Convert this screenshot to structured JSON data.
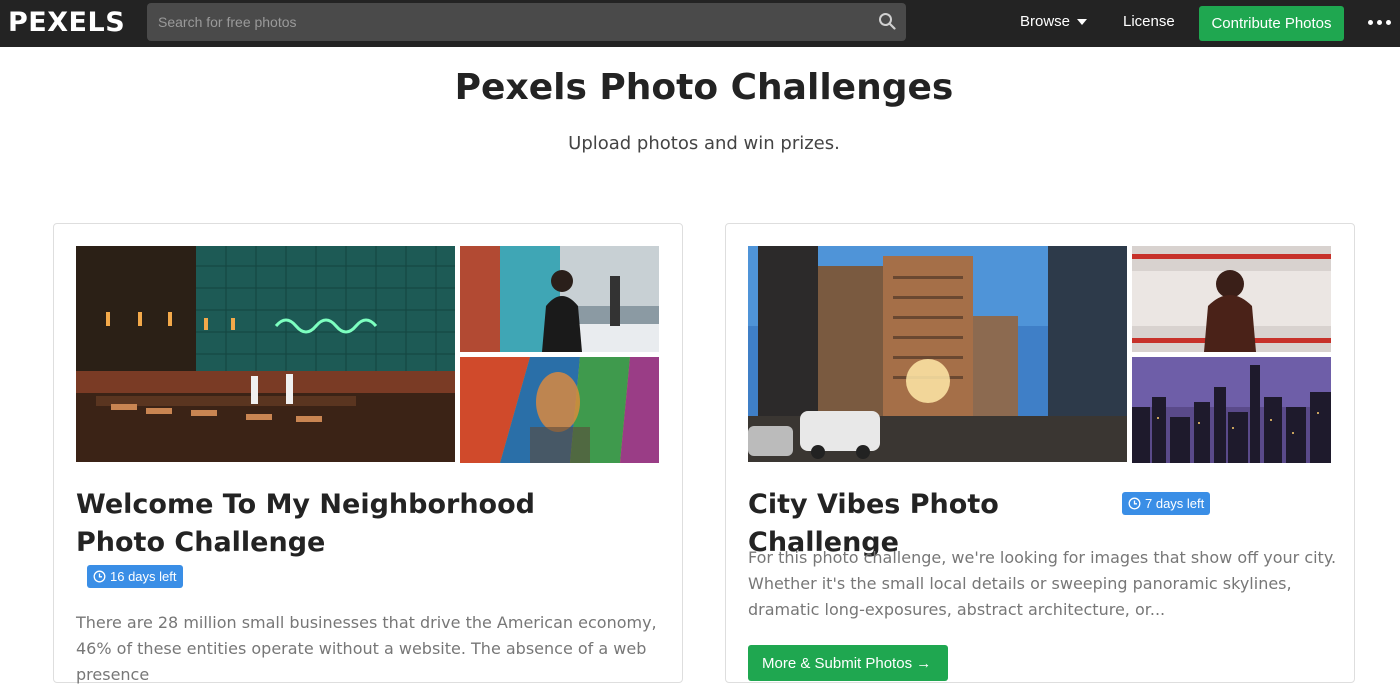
{
  "header": {
    "logo": "PEXELS",
    "search_placeholder": "Search for free photos",
    "browse_label": "Browse",
    "license_label": "License",
    "contribute_label": "Contribute Photos"
  },
  "page": {
    "title": "Pexels Photo Challenges",
    "subtitle": "Upload photos and win prizes."
  },
  "challenges": [
    {
      "title": "Welcome To My Neighborhood Photo Challenge",
      "badge": "16 days left",
      "description": "There are 28 million small businesses that drive the American economy, 46% of these entities operate without a website. The absence of a web presence"
    },
    {
      "title": "City Vibes Photo Challenge",
      "badge": "7 days left",
      "description": "For this photo challenge, we're looking for images that show off your city. Whether it's the small local details or sweeping panoramic skylines, dramatic long-exposures, abstract architecture, or...",
      "cta_label": "More & Submit Photos →"
    }
  ],
  "colors": {
    "topbar": "#232323",
    "accent_green": "#1fa750",
    "badge_blue": "#3a8ee6"
  }
}
